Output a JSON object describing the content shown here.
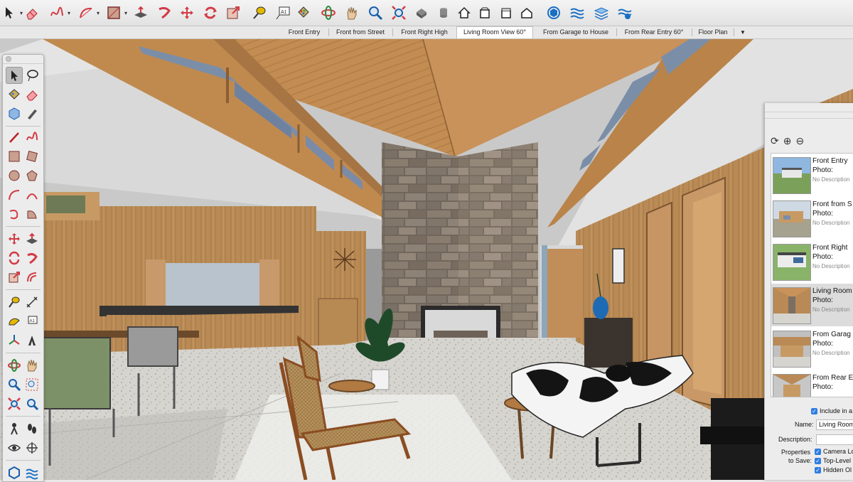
{
  "toolbar": {
    "tools": [
      {
        "name": "select-icon",
        "color": "#222222"
      },
      {
        "name": "eraser-icon",
        "color": "#d33b44"
      },
      {
        "name": "freehand-icon",
        "color": "#d33b44"
      },
      {
        "name": "arc-icon",
        "color": "#d33b44"
      },
      {
        "name": "rectangle-icon",
        "color": "#a03030"
      },
      {
        "name": "push-pull-icon",
        "color": "#d33b44"
      },
      {
        "name": "follow-me-icon",
        "color": "#d33b44"
      },
      {
        "name": "move-icon",
        "color": "#d33b44"
      },
      {
        "name": "rotate-icon",
        "color": "#d33b44"
      },
      {
        "name": "scale-icon",
        "color": "#a03030"
      },
      {
        "name": "tape-measure-icon",
        "color": "#e6b800"
      },
      {
        "name": "text-icon",
        "color": "#333333"
      },
      {
        "name": "paint-bucket-icon",
        "color": "#333333"
      },
      {
        "name": "orbit-icon",
        "color": "#d33b44"
      },
      {
        "name": "pan-icon",
        "color": "#d2a66b"
      },
      {
        "name": "zoom-icon",
        "color": "#1a5fa8"
      },
      {
        "name": "zoom-extents-icon",
        "color": "#d33b44"
      },
      {
        "name": "warehouse-icon",
        "color": "#555555"
      },
      {
        "name": "component-icon",
        "color": "#777777"
      },
      {
        "name": "home-view-icon",
        "color": "#333333"
      },
      {
        "name": "front-view-icon",
        "color": "#333333"
      },
      {
        "name": "side-view-icon",
        "color": "#333333"
      },
      {
        "name": "house-icon",
        "color": "#333333"
      },
      {
        "name": "extension-warehouse-icon",
        "color": "#1a6fc4"
      },
      {
        "name": "sandbox-icon",
        "color": "#1a6fc4"
      },
      {
        "name": "layers-icon",
        "color": "#1a6fc4"
      },
      {
        "name": "styles-icon",
        "color": "#1a6fc4"
      }
    ]
  },
  "scene_tabs": {
    "tabs": [
      "Front Entry",
      "Front from Street",
      "Front Right High",
      "Living Room View 60°",
      "From Garage to House",
      "From Rear Entry 60°",
      "Floor Plan"
    ],
    "active": "Living Room View 60°",
    "more_icon": "▼"
  },
  "tool_palette": {
    "tools": [
      "select-icon",
      "orbit-icon",
      "paint-bucket-icon",
      "eraser-icon",
      "component-icon",
      "tape-measure-icon",
      "line-icon",
      "freehand-icon",
      "rectangle-icon",
      "rotated-rectangle-icon",
      "circle-icon",
      "polygon-icon",
      "arc-icon",
      "pie-icon",
      "three-point-arc-icon",
      "two-point-arc-icon",
      "move-icon",
      "push-pull-icon",
      "rotate-icon",
      "follow-me-icon",
      "scale-icon",
      "offset-icon",
      "tape-measure-icon",
      "dimension-icon",
      "protractor-icon",
      "text-icon",
      "axes-icon",
      "3d-text-icon",
      "orbit-icon",
      "pan-icon",
      "zoom-icon",
      "zoom-window-icon",
      "zoom-extents-icon",
      "previous-view-icon",
      "position-camera-icon",
      "walk-icon",
      "look-around-icon",
      "section-plane-icon",
      "sandbox-icon",
      "contours-icon"
    ]
  },
  "scenes_panel": {
    "refresh_icon": "⟳",
    "add_icon": "⊕",
    "remove_icon": "⊖",
    "scenes": [
      {
        "name": "Front Entry",
        "photo": "Photo:",
        "desc": "No Description"
      },
      {
        "name": "Front from S",
        "photo": "Photo:",
        "desc": "No Description"
      },
      {
        "name": "Front Right",
        "photo": "Photo:",
        "desc": "No Description"
      },
      {
        "name": "Living Room",
        "photo": "Photo:",
        "desc": "No Description"
      },
      {
        "name": "From Garag",
        "photo": "Photo:",
        "desc": "No Description"
      },
      {
        "name": "From Rear E",
        "photo": "Photo:",
        "desc": ""
      }
    ],
    "selected_index": 3,
    "include_label": "Include in a",
    "name_label": "Name:",
    "name_value": "Living Room",
    "description_label": "Description:",
    "description_value": "",
    "properties_label": "Properties",
    "to_save_label": "to Save:",
    "properties": [
      "Camera Lo",
      "Top-Level",
      "Hidden Ol"
    ]
  }
}
